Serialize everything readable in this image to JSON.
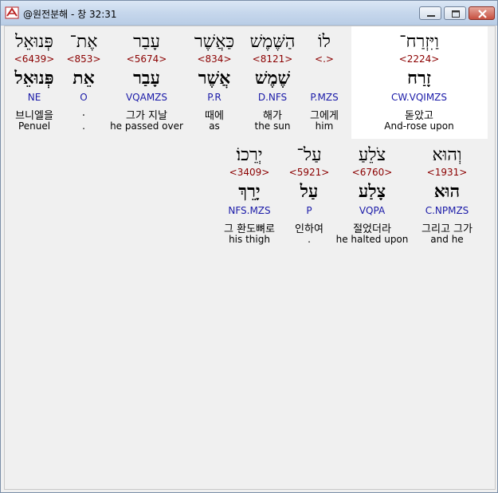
{
  "window": {
    "title": "@원전분해 - 창 32:31"
  },
  "row1": [
    {
      "word": "וַיִּזְרַח־",
      "strong": "<2224>",
      "lemma": "זָרַח",
      "parse": "CW.VQIMZS",
      "korean": "돋았고",
      "english": "And-rose upon"
    },
    {
      "word": "לוֹ",
      "strong": "<.>",
      "lemma": "",
      "parse": "P.MZS",
      "korean": "그에게",
      "english": "him"
    },
    {
      "word": "הַשֶּׁמֶשׁ",
      "strong": "<8121>",
      "lemma": "שֶׁמֶשׁ",
      "parse": "D.NFS",
      "korean": "해가",
      "english": "the sun"
    },
    {
      "word": "כַּאֲשֶׁר",
      "strong": "<834>",
      "lemma": "אֲשֶׁר",
      "parse": "P.R",
      "korean": "때에",
      "english": "as"
    },
    {
      "word": "עָבַר",
      "strong": "<5674>",
      "lemma": "עָבַר",
      "parse": "VQAMZS",
      "korean": "그가 지날",
      "english": "he passed over"
    },
    {
      "word": "אֶת־",
      "strong": "<853>",
      "lemma": "אֵת",
      "parse": "O",
      "korean": ".",
      "english": "."
    },
    {
      "word": "פְּנוּאֵל",
      "strong": "<6439>",
      "lemma": "פְּנוּאֵל",
      "parse": "NE",
      "korean": "브니엘을",
      "english": "Penuel"
    }
  ],
  "row2": [
    {
      "word": "וְהוּא",
      "strong": "<1931>",
      "lemma": "הוּא",
      "parse": "C.NPMZS",
      "korean": "그리고 그가",
      "english": "and he"
    },
    {
      "word": "צֹלֵעַ",
      "strong": "<6760>",
      "lemma": "צָלַע",
      "parse": "VQPA",
      "korean": "절었더라",
      "english": "he halted upon"
    },
    {
      "word": "עַל־",
      "strong": "<5921>",
      "lemma": "עַל",
      "parse": "P",
      "korean": "인하여",
      "english": "."
    },
    {
      "word": "יְרֵכוֹ׃",
      "strong": "<3409>",
      "lemma": "יָרֵךְ",
      "parse": "NFS.MZS",
      "korean": "그 환도뼈로",
      "english": "his thigh"
    }
  ]
}
